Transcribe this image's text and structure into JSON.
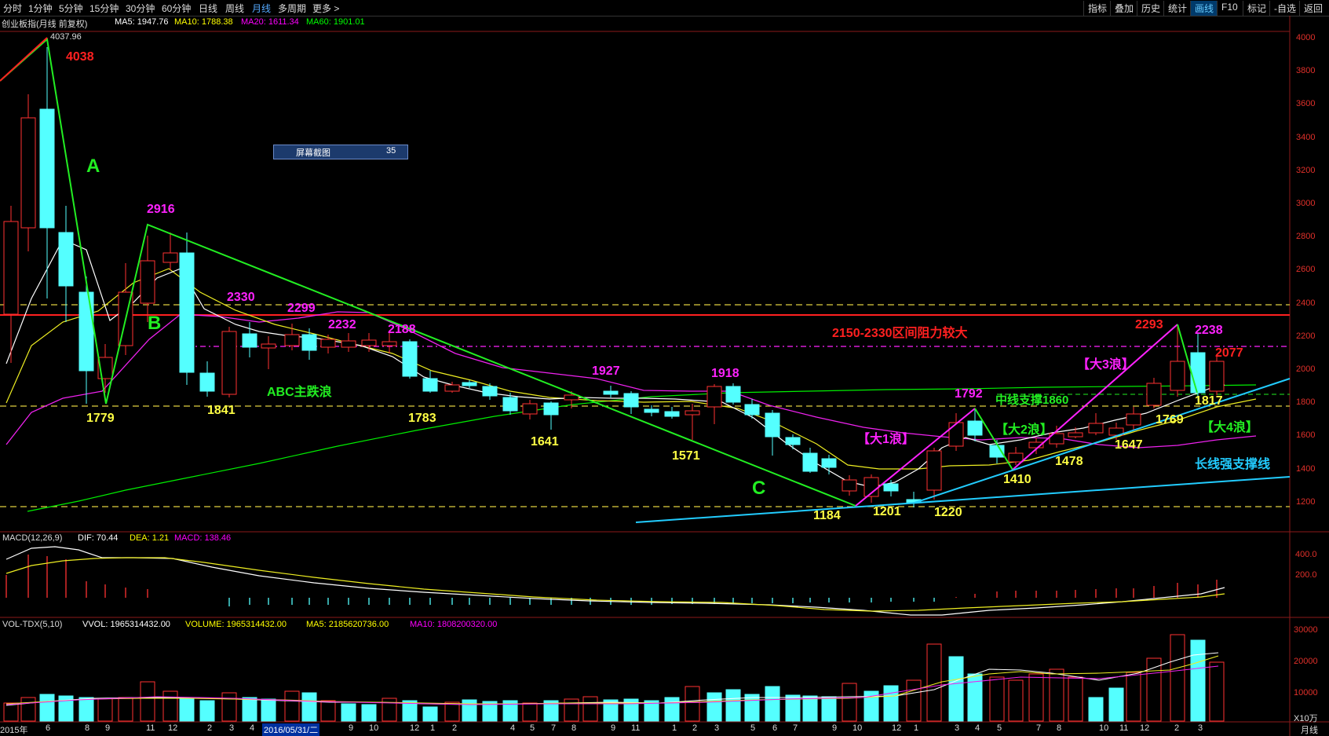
{
  "toolbar": {
    "periods": [
      "分时",
      "1分钟",
      "5分钟",
      "15分钟",
      "30分钟",
      "60分钟",
      "日线",
      "周线",
      "月线",
      "多周期",
      "更多 >"
    ],
    "active_period": "月线",
    "right_buttons": [
      "指标",
      "叠加",
      "历史",
      "统计",
      "画线",
      "F10",
      "标记",
      "-自选",
      "返回"
    ],
    "active_right": "画线"
  },
  "main_legend": {
    "name": "创业板指(月线 前复权)",
    "ma5": "MA5: 1947.76",
    "ma10": "MA10: 1788.38",
    "ma20": "MA20: 1611.34",
    "ma60": "MA60: 1901.01"
  },
  "screenshot_widget": {
    "label": "屏幕截图",
    "value": "35"
  },
  "high_marker": "4037.96",
  "annotations": {
    "p4038": "4038",
    "A": "A",
    "B": "B",
    "C": "C",
    "p2916": "2916",
    "p1779": "1779",
    "p1841": "1841",
    "p2330": "2330",
    "p2299": "2299",
    "p2232": "2232",
    "p2188": "2188",
    "p1783": "1783",
    "abc": "ABC主跌浪",
    "p1641": "1641",
    "p1927": "1927",
    "p1918": "1918",
    "p1571": "1571",
    "p1184": "1184",
    "p1201": "1201",
    "p1220": "1220",
    "p1792": "1792",
    "wave1": "【大1浪】",
    "wave2": "【大2浪】",
    "wave3": "【大3浪】",
    "wave4": "【大4浪】",
    "p1410": "1410",
    "p1478": "1478",
    "p1647": "1647",
    "p1769": "1769",
    "p1817": "1817",
    "p2293": "2293",
    "p2238": "2238",
    "p2077": "2077",
    "resist": "2150-2330区间阻力较大",
    "midsupport": "中线支撑1860",
    "longsupport": "长线强支撑线"
  },
  "y_axis_main": [
    "4000",
    "3800",
    "3600",
    "3400",
    "3200",
    "3000",
    "2800",
    "2600",
    "2400",
    "2200",
    "2000",
    "1800",
    "1600",
    "1400",
    "1200"
  ],
  "macd_legend": {
    "name": "MACD(12,26,9)",
    "dif": "DIF: 70.44",
    "dea": "DEA: 1.21",
    "macd": "MACD: 138.46"
  },
  "y_axis_macd": [
    "400.0",
    "200.0"
  ],
  "vol_legend": {
    "name": "VOL-TDX(5,10)",
    "vvol": "VVOL: 1965314432.00",
    "volume": "VOLUME: 1965314432.00",
    "ma5": "MA5: 2185620736.00",
    "ma10": "MA10: 1808200320.00"
  },
  "y_axis_vol": [
    "30000",
    "20000",
    "10000",
    "X10万"
  ],
  "x_dates": [
    "2015年",
    "6",
    "8",
    "9",
    "11",
    "12",
    "2",
    "3",
    "4",
    "2016/05/31/二",
    "9",
    "10",
    "12",
    "1",
    "2",
    "4",
    "5",
    "7",
    "8",
    "9",
    "11",
    "1",
    "2",
    "3",
    "5",
    "6",
    "7",
    "9",
    "10",
    "12",
    "1",
    "3",
    "4",
    "5",
    "7",
    "8",
    "10",
    "11",
    "12",
    "2",
    "3"
  ],
  "period_label": "月线",
  "colors": {
    "up": "#ff3232",
    "down": "#54ffff",
    "ma5": "#ffffff",
    "ma10": "#ffff00",
    "ma20": "#ff00ff",
    "ma60": "#00ff00",
    "green": "#22ee22",
    "magenta": "#ff22ff",
    "yellow": "#ffff44",
    "red": "#ff2020",
    "cyan": "#22ccff"
  }
}
